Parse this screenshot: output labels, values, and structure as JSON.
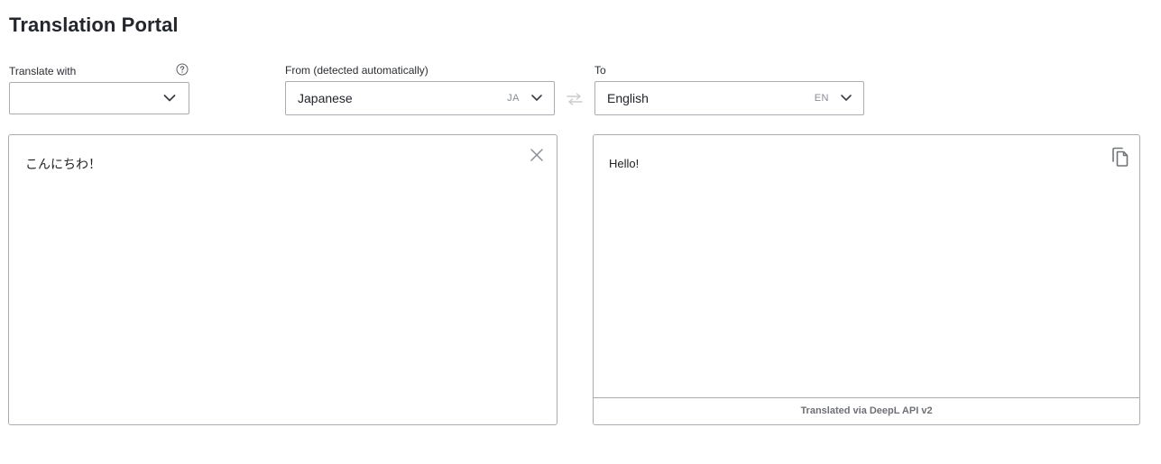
{
  "page": {
    "title": "Translation Portal"
  },
  "engine": {
    "label": "Translate with",
    "value": "",
    "help_icon": "question-circle-icon"
  },
  "source": {
    "label": "From (detected automatically)",
    "language": "Japanese",
    "code": "JA",
    "text": "こんにちわ！"
  },
  "target": {
    "label": "To",
    "language": "English",
    "code": "EN",
    "text": "Hello!",
    "footer": "Translated via DeepL API v2"
  },
  "icons": {
    "chevron": "chevron-down-icon",
    "swap": "swap-arrows-icon",
    "clear": "close-icon",
    "copy": "copy-icon"
  },
  "colors": {
    "border": "#a9acb0",
    "muted_text": "#8a8d92",
    "icon": "#707377",
    "swap_disabled": "#c9cccf"
  }
}
